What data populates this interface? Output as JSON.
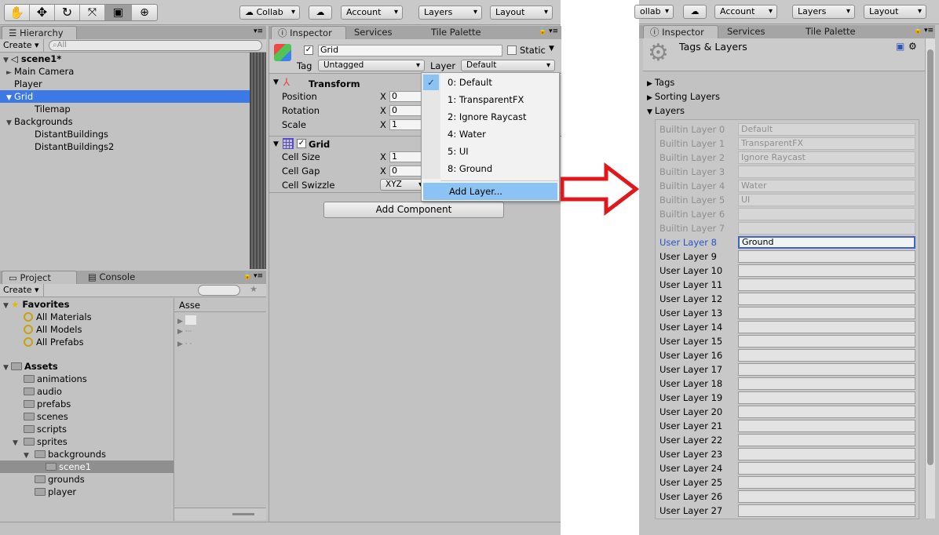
{
  "toolbar": {
    "tools": [
      "hand-tool-icon",
      "move-tool-icon",
      "rotate-tool-icon",
      "scale-tool-icon",
      "rect-tool-icon",
      "transform-tool-icon"
    ],
    "collab_label": "Collab",
    "account_label": "Account",
    "layers_label": "Layers",
    "layout_label": "Layout"
  },
  "hierarchy": {
    "tab_label": "Hierarchy",
    "create_label": "Create",
    "search_placeholder": "All",
    "scene_name": "scene1*",
    "items": [
      {
        "label": "Main Camera",
        "indent": 1,
        "arrow": "►"
      },
      {
        "label": "Player",
        "indent": 1,
        "arrow": ""
      },
      {
        "label": "Grid",
        "indent": 1,
        "arrow": "▼",
        "selected": true
      },
      {
        "label": "Tilemap",
        "indent": 2,
        "arrow": ""
      },
      {
        "label": "Backgrounds",
        "indent": 1,
        "arrow": "▼"
      },
      {
        "label": "DistantBuildings",
        "indent": 2,
        "arrow": ""
      },
      {
        "label": "DistantBuildings2",
        "indent": 2,
        "arrow": ""
      }
    ]
  },
  "project": {
    "tab_label": "Project",
    "console_label": "Console",
    "create_label": "Create",
    "favorites_label": "Favorites",
    "favorites": [
      "All Materials",
      "All Models",
      "All Prefabs"
    ],
    "assets_label": "Assets",
    "asset_folders": [
      {
        "label": "animations",
        "depth": 1,
        "arrow": ""
      },
      {
        "label": "audio",
        "depth": 1,
        "arrow": ""
      },
      {
        "label": "prefabs",
        "depth": 1,
        "arrow": ""
      },
      {
        "label": "scenes",
        "depth": 1,
        "arrow": ""
      },
      {
        "label": "scripts",
        "depth": 1,
        "arrow": ""
      },
      {
        "label": "sprites",
        "depth": 1,
        "arrow": "▼"
      },
      {
        "label": "backgrounds",
        "depth": 2,
        "arrow": "▼"
      },
      {
        "label": "scene1",
        "depth": 3,
        "arrow": "",
        "selected": true
      },
      {
        "label": "grounds",
        "depth": 2,
        "arrow": ""
      },
      {
        "label": "player",
        "depth": 2,
        "arrow": ""
      }
    ],
    "right_header": "Asse"
  },
  "inspector": {
    "tab_label": "Inspector",
    "services_label": "Services",
    "tile_palette_label": "Tile Palette",
    "object_name": "Grid",
    "static_label": "Static",
    "tag_label": "Tag",
    "tag_value": "Untagged",
    "layer_label": "Layer",
    "layer_value": "Default",
    "transform_label": "Transform",
    "transform_rows": [
      {
        "label": "Position",
        "x": "0"
      },
      {
        "label": "Rotation",
        "x": "0"
      },
      {
        "label": "Scale",
        "x": "1"
      }
    ],
    "grid_label": "Grid",
    "grid_rows": [
      {
        "label": "Cell Size",
        "x": "1"
      },
      {
        "label": "Cell Gap",
        "x": "0"
      }
    ],
    "axis_label": "X",
    "cell_swizzle_label": "Cell Swizzle",
    "cell_swizzle_value": "XYZ",
    "add_component_label": "Add Component"
  },
  "layer_menu": {
    "items": [
      "0: Default",
      "1: TransparentFX",
      "2: Ignore Raycast",
      "4: Water",
      "5: UI",
      "8: Ground"
    ],
    "checked_index": 0,
    "add_layer_label": "Add Layer..."
  },
  "right_panel": {
    "tab_label": "Inspector",
    "services_label": "Services",
    "tile_palette_label": "Tile Palette",
    "collab_label": "ollab",
    "account_label": "Account",
    "layers_label": "Layers",
    "layout_label": "Layout",
    "title": "Tags & Layers",
    "sections": [
      "Tags",
      "Sorting Layers",
      "Layers"
    ],
    "layers": [
      {
        "name": "Builtin Layer 0",
        "value": "Default",
        "type": "builtin"
      },
      {
        "name": "Builtin Layer 1",
        "value": "TransparentFX",
        "type": "builtin"
      },
      {
        "name": "Builtin Layer 2",
        "value": "Ignore Raycast",
        "type": "builtin"
      },
      {
        "name": "Builtin Layer 3",
        "value": "",
        "type": "builtin"
      },
      {
        "name": "Builtin Layer 4",
        "value": "Water",
        "type": "builtin"
      },
      {
        "name": "Builtin Layer 5",
        "value": "UI",
        "type": "builtin"
      },
      {
        "name": "Builtin Layer 6",
        "value": "",
        "type": "builtin"
      },
      {
        "name": "Builtin Layer 7",
        "value": "",
        "type": "builtin"
      },
      {
        "name": "User Layer 8",
        "value": "Ground",
        "type": "active"
      },
      {
        "name": "User Layer 9",
        "value": "",
        "type": "user"
      },
      {
        "name": "User Layer 10",
        "value": "",
        "type": "user"
      },
      {
        "name": "User Layer 11",
        "value": "",
        "type": "user"
      },
      {
        "name": "User Layer 12",
        "value": "",
        "type": "user"
      },
      {
        "name": "User Layer 13",
        "value": "",
        "type": "user"
      },
      {
        "name": "User Layer 14",
        "value": "",
        "type": "user"
      },
      {
        "name": "User Layer 15",
        "value": "",
        "type": "user"
      },
      {
        "name": "User Layer 16",
        "value": "",
        "type": "user"
      },
      {
        "name": "User Layer 17",
        "value": "",
        "type": "user"
      },
      {
        "name": "User Layer 18",
        "value": "",
        "type": "user"
      },
      {
        "name": "User Layer 19",
        "value": "",
        "type": "user"
      },
      {
        "name": "User Layer 20",
        "value": "",
        "type": "user"
      },
      {
        "name": "User Layer 21",
        "value": "",
        "type": "user"
      },
      {
        "name": "User Layer 22",
        "value": "",
        "type": "user"
      },
      {
        "name": "User Layer 23",
        "value": "",
        "type": "user"
      },
      {
        "name": "User Layer 24",
        "value": "",
        "type": "user"
      },
      {
        "name": "User Layer 25",
        "value": "",
        "type": "user"
      },
      {
        "name": "User Layer 26",
        "value": "",
        "type": "user"
      },
      {
        "name": "User Layer 27",
        "value": "",
        "type": "user"
      }
    ]
  },
  "colors": {
    "selection": "#3c79e6",
    "menu_highlight": "#8cc3f5",
    "arrow": "#e0181b",
    "active_layer": "#2a54c9"
  }
}
